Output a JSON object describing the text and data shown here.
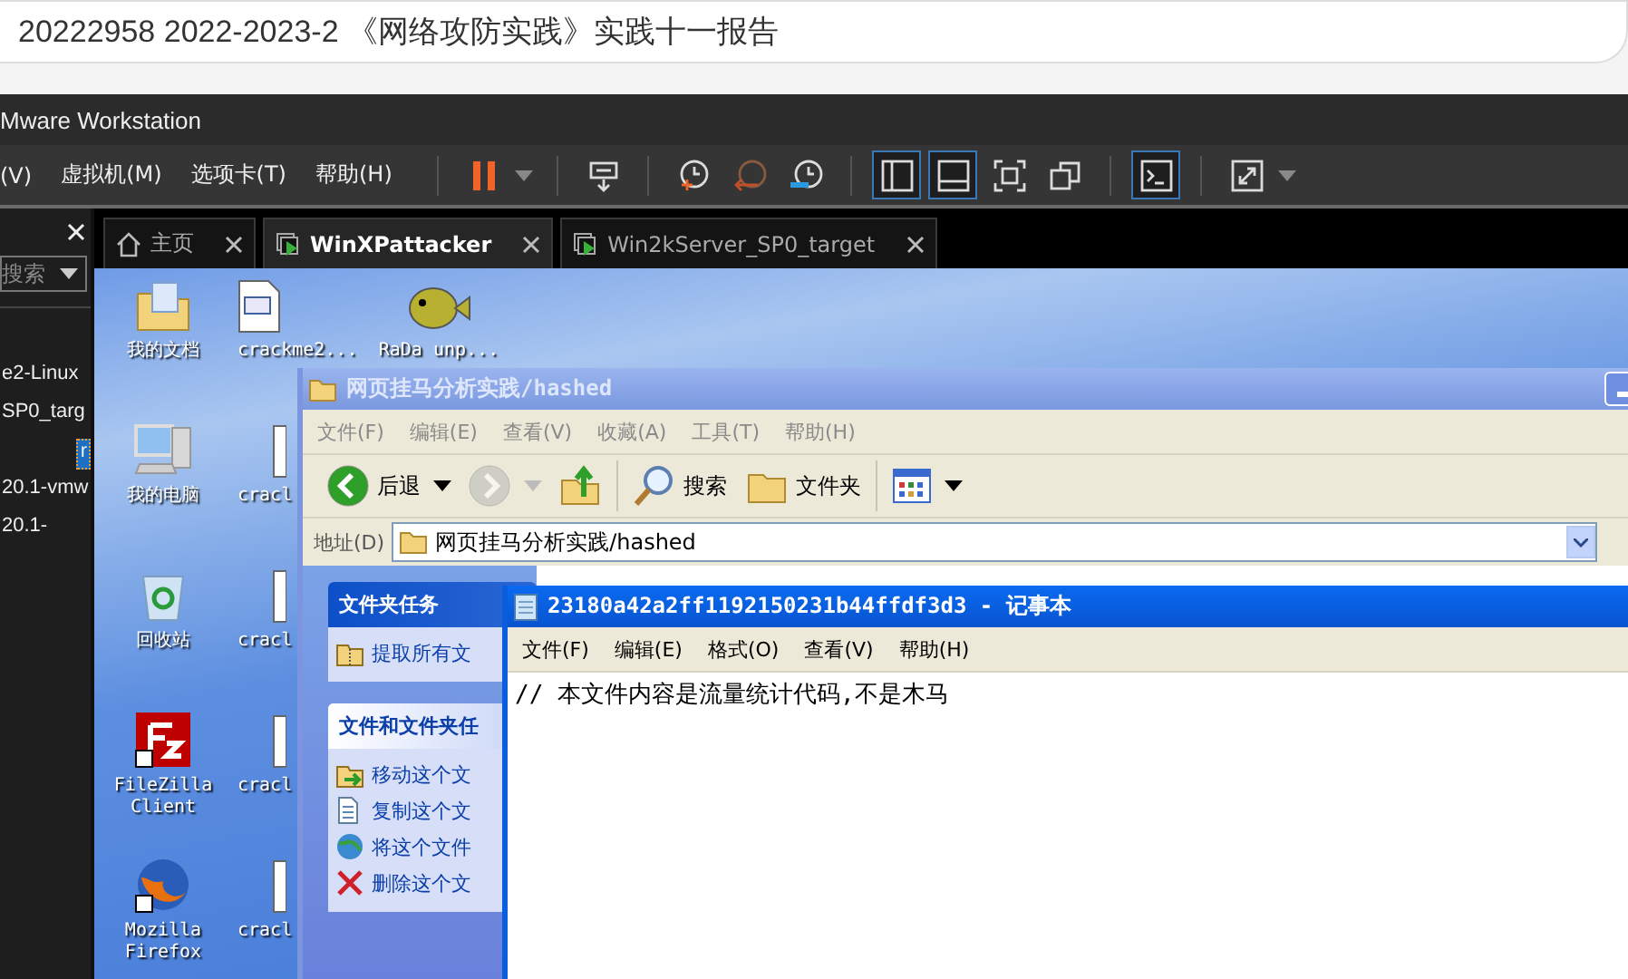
{
  "browser": {
    "title": "20222958 2022-2023-2 《网络攻防实践》实践十一报告"
  },
  "vmware": {
    "title": "Mware Workstation",
    "menu": [
      "(V)",
      "虚拟机(M)",
      "选项卡(T)",
      "帮助(H)"
    ],
    "toolbar_groups": [
      [
        {
          "kind": "pause",
          "selected": false
        }
      ],
      [
        {
          "kind": "send-keys",
          "selected": false
        }
      ],
      [
        {
          "kind": "snapshot-take",
          "selected": false
        },
        {
          "kind": "snapshot-revert",
          "selected": false
        },
        {
          "kind": "snapshot-manager",
          "selected": false
        }
      ],
      [
        {
          "kind": "view-sidebar",
          "selected": true
        },
        {
          "kind": "view-thumbnails",
          "selected": true
        },
        {
          "kind": "fullscreen",
          "selected": false
        },
        {
          "kind": "unity",
          "selected": false
        }
      ],
      [
        {
          "kind": "console",
          "selected": true
        }
      ],
      [
        {
          "kind": "stretch",
          "selected": false
        }
      ]
    ],
    "library": {
      "search_placeholder": "搜索",
      "items": [
        {
          "label": "e2-Linux",
          "selected": false
        },
        {
          "label": "SP0_targ",
          "selected": false
        },
        {
          "label": "r",
          "selected": true
        },
        {
          "label": "20.1-vmw",
          "selected": false
        },
        {
          "label": "20.1-",
          "selected": false
        }
      ]
    },
    "tabs": [
      {
        "label": "主页",
        "kind": "home",
        "selected": false
      },
      {
        "label": "WinXPattacker",
        "kind": "vm",
        "selected": true
      },
      {
        "label": "Win2kServer_SP0_target",
        "kind": "vm",
        "selected": false
      }
    ]
  },
  "desktop": {
    "icon_columns": [
      [
        {
          "label": "我的文档",
          "kind": "documents"
        },
        {
          "label": "我的电脑",
          "kind": "computer"
        },
        {
          "label": "回收站",
          "kind": "recycle"
        },
        {
          "label": "FileZilla Client",
          "kind": "filezilla"
        },
        {
          "label": "Mozilla Firefox",
          "kind": "firefox"
        }
      ],
      [
        {
          "label": "crackme2...",
          "kind": "program"
        },
        {
          "label": "cracl",
          "kind": "partial"
        },
        {
          "label": "cracl",
          "kind": "partial"
        },
        {
          "label": "cracl",
          "kind": "partial"
        },
        {
          "label": "cracl",
          "kind": "partial"
        }
      ],
      [
        {
          "label": "RaDa unp...",
          "kind": "fish"
        }
      ]
    ]
  },
  "explorer": {
    "title": "网页挂马分析实践/hashed",
    "active": false,
    "menu": [
      "文件(F)",
      "编辑(E)",
      "查看(V)",
      "收藏(A)",
      "工具(T)",
      "帮助(H)"
    ],
    "toolbar": [
      {
        "kind": "back",
        "label": "后退",
        "disabled": false
      },
      {
        "kind": "forward",
        "disabled": true
      },
      {
        "kind": "up",
        "disabled": false
      },
      {
        "kind": "search",
        "label": "搜索",
        "disabled": false
      },
      {
        "kind": "folders",
        "label": "文件夹",
        "disabled": false
      },
      {
        "kind": "views",
        "disabled": false
      }
    ],
    "address_label": "地址(D)",
    "address": "网页挂马分析实践/hashed",
    "task_panels": [
      {
        "title": "文件夹任务",
        "items": [
          {
            "label": "提取所有文",
            "kind": "extract"
          }
        ]
      },
      {
        "title": "文件和文件夹任",
        "items": [
          {
            "label": "移动这个文",
            "kind": "move"
          },
          {
            "label": "复制这个文",
            "kind": "copy"
          },
          {
            "label": "将这个文件",
            "kind": "publish"
          },
          {
            "label": "删除这个文",
            "kind": "delete"
          }
        ]
      }
    ]
  },
  "notepad": {
    "title": "23180a42a2ff1192150231b44ffdf3d3 - 记事本",
    "active": true,
    "menu": [
      "文件(F)",
      "编辑(E)",
      "格式(O)",
      "查看(V)",
      "帮助(H)"
    ],
    "content": "// 本文件内容是流量统计代码,不是木马"
  }
}
